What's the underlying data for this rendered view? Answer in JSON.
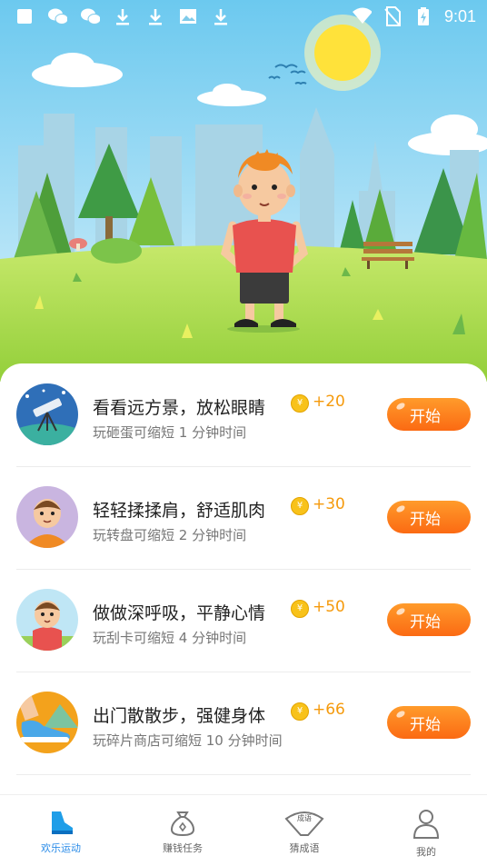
{
  "status_bar": {
    "time": "9:01"
  },
  "tasks": [
    {
      "title": "看看远方景，放松眼睛",
      "reward": "+20",
      "subtitle": "玩砸蛋可缩短 1 分钟时间",
      "button": "开始",
      "coin_glyph": "¥"
    },
    {
      "title": "轻轻揉揉肩，舒适肌肉",
      "reward": "+30",
      "subtitle": "玩转盘可缩短 2 分钟时间",
      "button": "开始",
      "coin_glyph": "¥"
    },
    {
      "title": "做做深呼吸，平静心情",
      "reward": "+50",
      "subtitle": "玩刮卡可缩短 4 分钟时间",
      "button": "开始",
      "coin_glyph": "¥"
    },
    {
      "title": "出门散散步，强健身体",
      "reward": "+66",
      "subtitle": "玩碎片商店可缩短 10 分钟时间",
      "button": "开始",
      "coin_glyph": "¥"
    }
  ],
  "nav": [
    {
      "label": "欢乐运动",
      "icon": "shoe-icon",
      "active": true
    },
    {
      "label": "赚钱任务",
      "icon": "money-bag-icon",
      "active": false
    },
    {
      "label": "猜成语",
      "icon": "fan-icon",
      "icon_text": "成语",
      "active": false
    },
    {
      "label": "我的",
      "icon": "person-icon",
      "active": false
    }
  ],
  "colors": {
    "accent": "#2b8ce8",
    "button": "#fb7a18",
    "reward": "#f59a0c",
    "sky": "#7fd0f0",
    "grass": "#b9e15a"
  }
}
